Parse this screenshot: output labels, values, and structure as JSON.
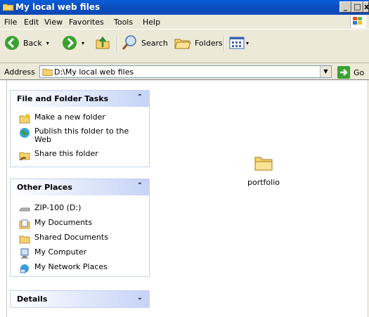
{
  "window": {
    "title": "My local web files"
  },
  "menu": [
    "File",
    "Edit",
    "View",
    "Favorites",
    "Tools",
    "Help"
  ],
  "toolbar": {
    "back": "Back",
    "search": "Search",
    "folders": "Folders"
  },
  "address": {
    "label": "Address",
    "value": "D:\\My local web files",
    "go": "Go"
  },
  "panels": {
    "file_tasks": {
      "title": "File and Folder Tasks",
      "items": [
        "Make a new folder",
        "Publish this folder to the Web",
        "Share this folder"
      ]
    },
    "other_places": {
      "title": "Other Places",
      "items": [
        "ZIP-100 (D:)",
        "My Documents",
        "Shared Documents",
        "My Computer",
        "My Network Places"
      ]
    },
    "details": {
      "title": "Details"
    }
  },
  "files": [
    {
      "name": "portfolio",
      "icon": "folder-icon"
    }
  ]
}
